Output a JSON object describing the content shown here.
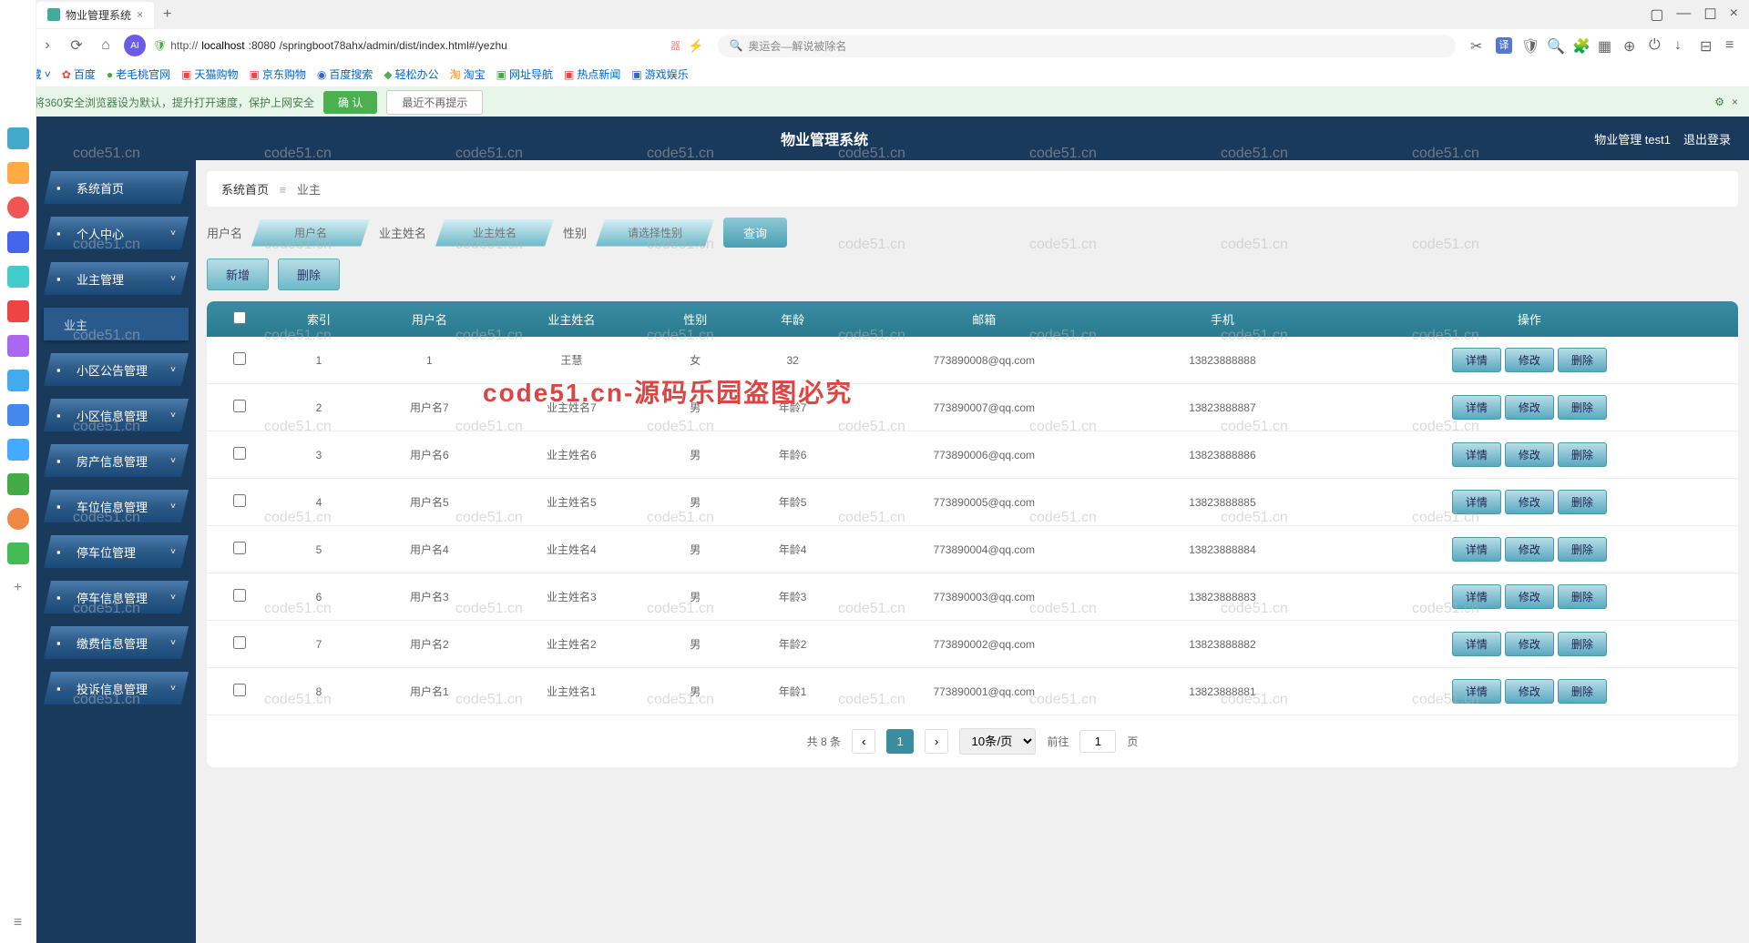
{
  "browser": {
    "tab_title": "物业管理系统",
    "url_prefix": "http://",
    "url_host": "localhost",
    "url_port": ":8080",
    "url_path": "/springboot78ahx/admin/dist/index.html#/yezhu",
    "search_placeholder": "奥运会—解说被除名"
  },
  "bookmarks": [
    "收藏",
    "百度",
    "老毛桃官网",
    "天猫购物",
    "京东购物",
    "百度搜索",
    "轻松办公",
    "淘宝",
    "网址导航",
    "热点新闻",
    "游戏娱乐"
  ],
  "notice": {
    "text": "将360安全浏览器设为默认，提升打开速度，保护上网安全",
    "confirm": "确 认",
    "dismiss": "最近不再提示"
  },
  "app": {
    "title": "物业管理系统",
    "user": "物业管理 test1",
    "logout": "退出登录"
  },
  "sidebar": {
    "items": [
      {
        "label": "系统首页",
        "icon": "home",
        "expandable": false
      },
      {
        "label": "个人中心",
        "icon": "user",
        "expandable": true
      },
      {
        "label": "业主管理",
        "icon": "grid",
        "expandable": true,
        "active": false
      },
      {
        "label": "业主",
        "sub": true
      },
      {
        "label": "小区公告管理",
        "icon": "doc",
        "expandable": true
      },
      {
        "label": "小区信息管理",
        "icon": "info",
        "expandable": true
      },
      {
        "label": "房产信息管理",
        "icon": "house",
        "expandable": true
      },
      {
        "label": "车位信息管理",
        "icon": "car",
        "expandable": true
      },
      {
        "label": "停车位管理",
        "icon": "park",
        "expandable": true
      },
      {
        "label": "停车信息管理",
        "icon": "park2",
        "expandable": true
      },
      {
        "label": "缴费信息管理",
        "icon": "pay",
        "expandable": true
      },
      {
        "label": "投诉信息管理",
        "icon": "complain",
        "expandable": true
      }
    ]
  },
  "breadcrumb": {
    "home": "系统首页",
    "current": "业主"
  },
  "filters": {
    "username_label": "用户名",
    "username_ph": "用户名",
    "name_label": "业主姓名",
    "name_ph": "业主姓名",
    "gender_label": "性别",
    "gender_ph": "请选择性别",
    "query": "查询"
  },
  "actions": {
    "add": "新增",
    "delete": "删除"
  },
  "table": {
    "headers": [
      "",
      "索引",
      "用户名",
      "业主姓名",
      "性别",
      "年龄",
      "邮箱",
      "手机",
      "操作"
    ],
    "rows": [
      {
        "idx": "1",
        "user": "1",
        "name": "王慧",
        "gender": "女",
        "age": "32",
        "email": "773890008@qq.com",
        "phone": "13823888888"
      },
      {
        "idx": "2",
        "user": "用户名7",
        "name": "业主姓名7",
        "gender": "男",
        "age": "年龄7",
        "email": "773890007@qq.com",
        "phone": "13823888887"
      },
      {
        "idx": "3",
        "user": "用户名6",
        "name": "业主姓名6",
        "gender": "男",
        "age": "年龄6",
        "email": "773890006@qq.com",
        "phone": "13823888886"
      },
      {
        "idx": "4",
        "user": "用户名5",
        "name": "业主姓名5",
        "gender": "男",
        "age": "年龄5",
        "email": "773890005@qq.com",
        "phone": "13823888885"
      },
      {
        "idx": "5",
        "user": "用户名4",
        "name": "业主姓名4",
        "gender": "男",
        "age": "年龄4",
        "email": "773890004@qq.com",
        "phone": "13823888884"
      },
      {
        "idx": "6",
        "user": "用户名3",
        "name": "业主姓名3",
        "gender": "男",
        "age": "年龄3",
        "email": "773890003@qq.com",
        "phone": "13823888883"
      },
      {
        "idx": "7",
        "user": "用户名2",
        "name": "业主姓名2",
        "gender": "男",
        "age": "年龄2",
        "email": "773890002@qq.com",
        "phone": "13823888882"
      },
      {
        "idx": "8",
        "user": "用户名1",
        "name": "业主姓名1",
        "gender": "男",
        "age": "年龄1",
        "email": "773890001@qq.com",
        "phone": "13823888881"
      }
    ],
    "row_actions": {
      "detail": "详情",
      "edit": "修改",
      "delete": "删除"
    }
  },
  "pager": {
    "total": "共 8 条",
    "page": "1",
    "size": "10条/页",
    "goto_pre": "前往",
    "goto_val": "1",
    "goto_post": "页"
  },
  "watermark": {
    "text": "code51.cn",
    "red": "code51.cn-源码乐园盗图必究"
  }
}
